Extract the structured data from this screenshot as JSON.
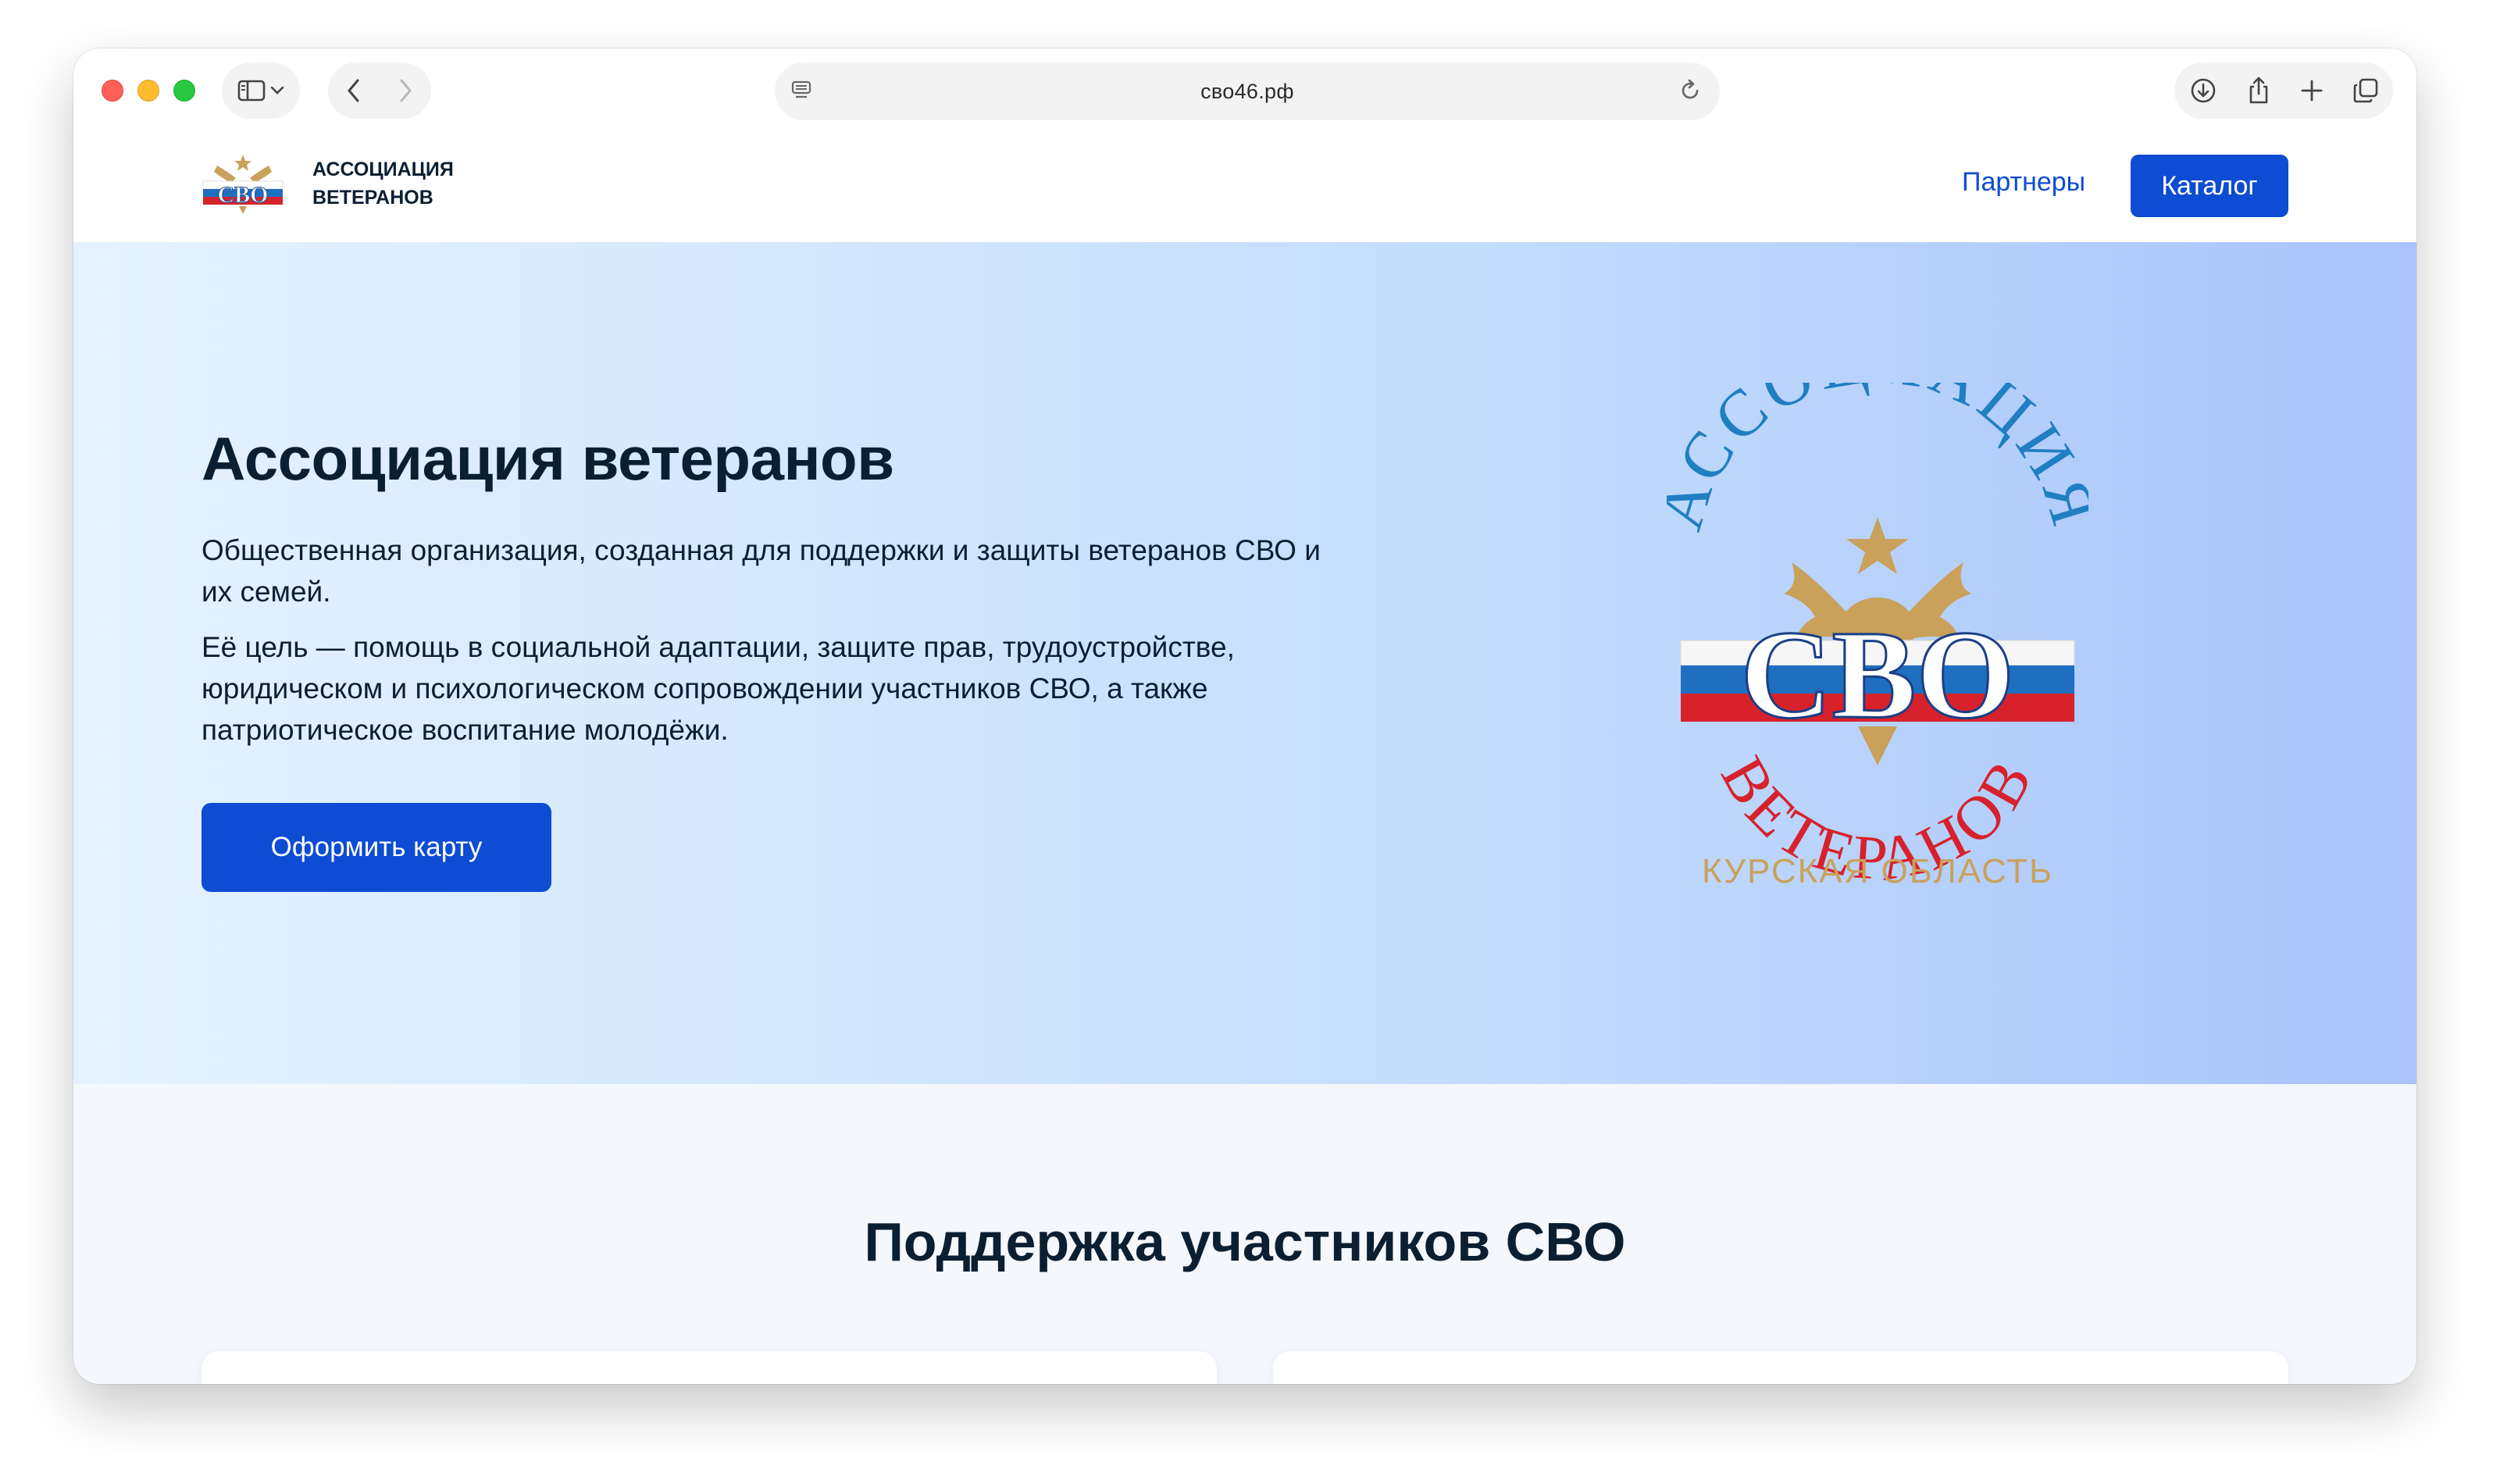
{
  "browser": {
    "url": "сво46.рф",
    "icons": [
      "sidebar-icon",
      "chevron-down-icon",
      "back-icon",
      "forward-icon",
      "page-menu-icon",
      "reload-icon",
      "download-icon",
      "share-icon",
      "new-tab-icon",
      "tabs-overview-icon"
    ]
  },
  "header": {
    "brand_line1": "АССОЦИАЦИЯ",
    "brand_line2": "ВЕТЕРАНОВ",
    "logo_text": "СВО",
    "nav_partners": "Партнеры",
    "catalog_button": "Каталог"
  },
  "hero": {
    "title": "Ассоциация ветеранов",
    "paragraph1": "Общественная организация, созданная для поддержки и защиты ветеранов СВО и их семей.",
    "paragraph2": "Её цель — помощь в социальной адаптации, защите прав, трудоустройстве, юридическом и психологическом сопровождении участников СВО, а также патриотическое воспитание молодёжи.",
    "cta_button": "Оформить карту",
    "emblem": {
      "top_arc": "АССОЦИАЦИЯ",
      "center": "СВО",
      "bottom_arc": "ВЕТЕРАНОВ",
      "region": "КУРСКАЯ ОБЛАСТЬ"
    }
  },
  "section": {
    "title": "Поддержка участников СВО"
  },
  "colors": {
    "primary": "#0d4cd3",
    "text": "#0b1f33",
    "emblem_blue": "#1f7fc1",
    "emblem_red": "#d7222c",
    "emblem_gold": "#c9a15b"
  }
}
